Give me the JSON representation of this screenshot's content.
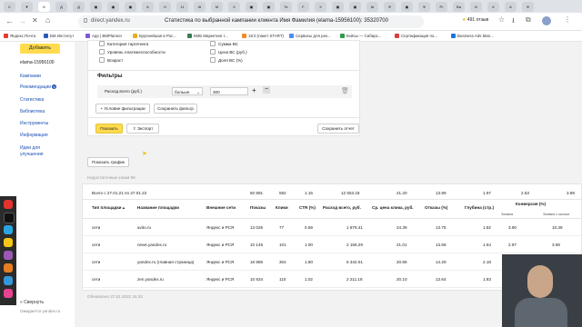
{
  "browser": {
    "tabs": [
      "С",
      "▼",
      "К",
      "Д",
      "Д",
      "▣",
      "▣",
      "▣",
      "А",
      "Н",
      "11",
      "Al",
      "М",
      "Х",
      "▣",
      "▣",
      "Te",
      "F",
      "Х",
      "▣",
      "▣",
      "Ш",
      "Ф",
      "▣",
      "Ф",
      "Pr",
      "Ва",
      "N",
      "К",
      "А",
      "Ф"
    ],
    "address": "direct.yandex.ru",
    "page_title": "Статистика по выбранной кампании клиента Имя Фамилия (elama-15956100): 35320700",
    "rating": "491 отзыв",
    "bookmarks": [
      {
        "label": "Яндекс.Почта",
        "color": "#e63a2e"
      },
      {
        "label": "БМ Институт",
        "color": "#2c5ab7"
      },
      {
        "label": "App | BMPlanner",
        "color": "#7f56d9"
      },
      {
        "label": "Крупнейшая в Рос...",
        "color": "#e0b020"
      },
      {
        "label": "КМБ Маркетинг I...",
        "color": "#3b7a57"
      },
      {
        "label": "18.0 (пакет START)",
        "color": "#f28c28"
      },
      {
        "label": "Сервисы для рек...",
        "color": "#4c8bf5"
      },
      {
        "label": "Кейсы — Сибирс...",
        "color": "#2e9b4a"
      },
      {
        "label": "Сертификация по...",
        "color": "#d93f3f"
      },
      {
        "label": "Business Ads Man...",
        "color": "#1b74e4"
      }
    ]
  },
  "sidebar": {
    "add_button": "Добавить",
    "account": "elama-15956100",
    "items": [
      "Кампании",
      "Рекомендации",
      "Статистика",
      "Библиотека",
      "Инструменты",
      "Информация",
      "Идеи для",
      "улучшения"
    ],
    "reco_badge": "6",
    "collapse": "Свернуть",
    "status": "Ожидается yandex.ru"
  },
  "params": {
    "left": [
      "Категория таргетинга",
      "Уровень платежеспособности",
      "Возраст"
    ],
    "right": [
      "Сумма ВС",
      "Цена ВС (руб.)",
      "Доля ВС (%)"
    ]
  },
  "filters": {
    "title": "Фильтры",
    "field": "Расход всего (руб.)",
    "op": "больше",
    "value": "300",
    "add_condition": "Условие фильтрации",
    "save_filter": "Сохранить фильтр",
    "show": "Показать",
    "export": "Экспорт",
    "save_report": "Сохранить отчет"
  },
  "chart_btn": "Показать график",
  "insufficient": "Недостаточные клики 99",
  "totals": {
    "label": "Всего с 27.01.21 по 27.01.22",
    "values": [
      "50 891",
      "592",
      "1.16",
      "12 553.18",
      "21.20",
      "13.99",
      "1.97",
      "2.53",
      "3.89"
    ]
  },
  "table": {
    "headers": [
      "Тип площадки",
      "Название площадки",
      "Внешние сети",
      "Показы",
      "Клики",
      "CTR (%)",
      "Расход всего, руб.",
      "Ср. цена клика, руб.",
      "Отказы (%)",
      "Глубина (стр.)",
      "Конверсия (%)"
    ],
    "subheaders": [
      "Заявка",
      "Заявка с киоски"
    ],
    "rows": [
      [
        "сети",
        "avito.ru",
        "Яндекс и РСЯ",
        "13 026",
        "77",
        "0.59",
        "1 878.41",
        "24.39",
        "13.75",
        "1.82",
        "3.90",
        "10.39"
      ],
      [
        "сети",
        "news.yandex.ru",
        "Яндекс и РСЯ",
        "10 146",
        "101",
        "1.00",
        "2 158.29",
        "21.01",
        "13.68",
        "1.64",
        "2.97",
        "3.96"
      ],
      [
        "сети",
        "yandex.ru (главная страница)",
        "Яндекс и РСЯ",
        "16 885",
        "304",
        "1.80",
        "6 342.01",
        "20.86",
        "14.29",
        "2.18",
        "",
        ""
      ],
      [
        "сети",
        "zen.yandex.ru",
        "Яндекс и РСЯ",
        "10 834",
        "110",
        "1.02",
        "2 211.18",
        "20.10",
        "13.64",
        "1.83",
        "",
        ""
      ]
    ]
  },
  "updated": "Обновлено 27.01.2022 16:20",
  "taskbar_time": "",
  "colors": {
    "accent": "#ffdb4d",
    "link": "#1a4fb5",
    "dock": "#2b2b2b"
  }
}
